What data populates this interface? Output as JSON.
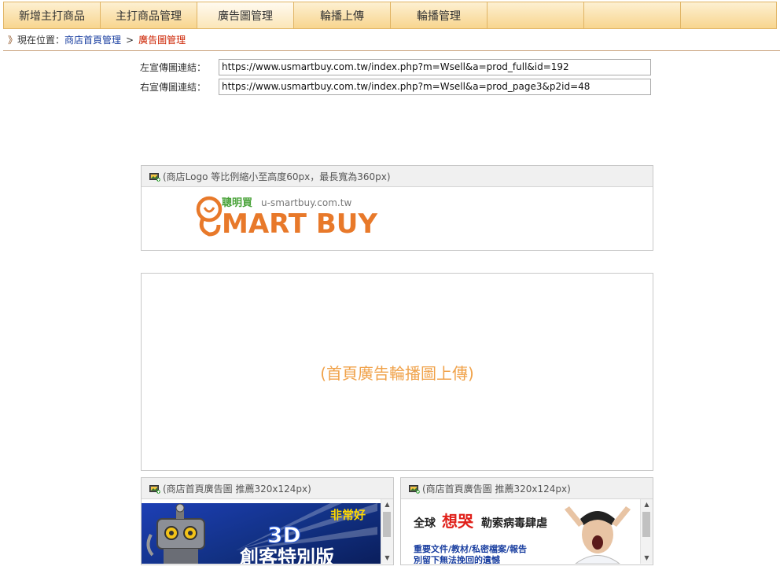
{
  "tabs": [
    {
      "label": "新增主打商品",
      "active": false
    },
    {
      "label": "主打商品管理",
      "active": false
    },
    {
      "label": "廣告圖管理",
      "active": true
    },
    {
      "label": "輪播上傳",
      "active": false
    },
    {
      "label": "輪播管理",
      "active": false
    },
    {
      "label": "",
      "active": false
    },
    {
      "label": "",
      "active": false
    },
    {
      "label": "",
      "active": false
    }
  ],
  "breadcrumb": {
    "arrows": "》",
    "prefix": "現在位置：",
    "home": "商店首頁管理",
    "separator": ">",
    "current": "廣告圖管理"
  },
  "links": {
    "left_label": "左宣傳圖連結：",
    "left_value": "https://www.usmartbuy.com.tw/index.php?m=Wsell&a=prod_full&id=192",
    "right_label": "右宣傳圖連結：",
    "right_value": "https://www.usmartbuy.com.tw/index.php?m=Wsell&a=prod_page3&p2id=48"
  },
  "logo_panel": {
    "caption": "(商店Logo 等比例縮小至高度60px，最長寬為360px)",
    "logo_cn": "聰明買",
    "logo_domain": "u-smartbuy.com.tw",
    "logo_text": "MART BUY"
  },
  "carousel_panel": {
    "text": "(首頁廣告輪播圖上傳)"
  },
  "ad_panels": [
    {
      "caption": "(商店首頁廣告圖 推薦320x124px)",
      "banner_tag": "非常好",
      "banner_main": "3D",
      "banner_sub": "創客特別版"
    },
    {
      "caption": "(商店首頁廣告圖 推薦320x124px)",
      "headline_a": "全球",
      "headline_b": "想哭",
      "headline_c": "勒索病毒肆虐",
      "sub_line": "重要文件/教材/私密檔案/報告",
      "sub_line2": "別留下無法挽回的遺憾"
    }
  ],
  "colors": {
    "tab_border": "#e0b464",
    "accent_orange": "#e8792a",
    "upload_text": "#f0a24a",
    "breadcrumb_current": "#cc2200",
    "breadcrumb_link": "#1a3fa0"
  }
}
